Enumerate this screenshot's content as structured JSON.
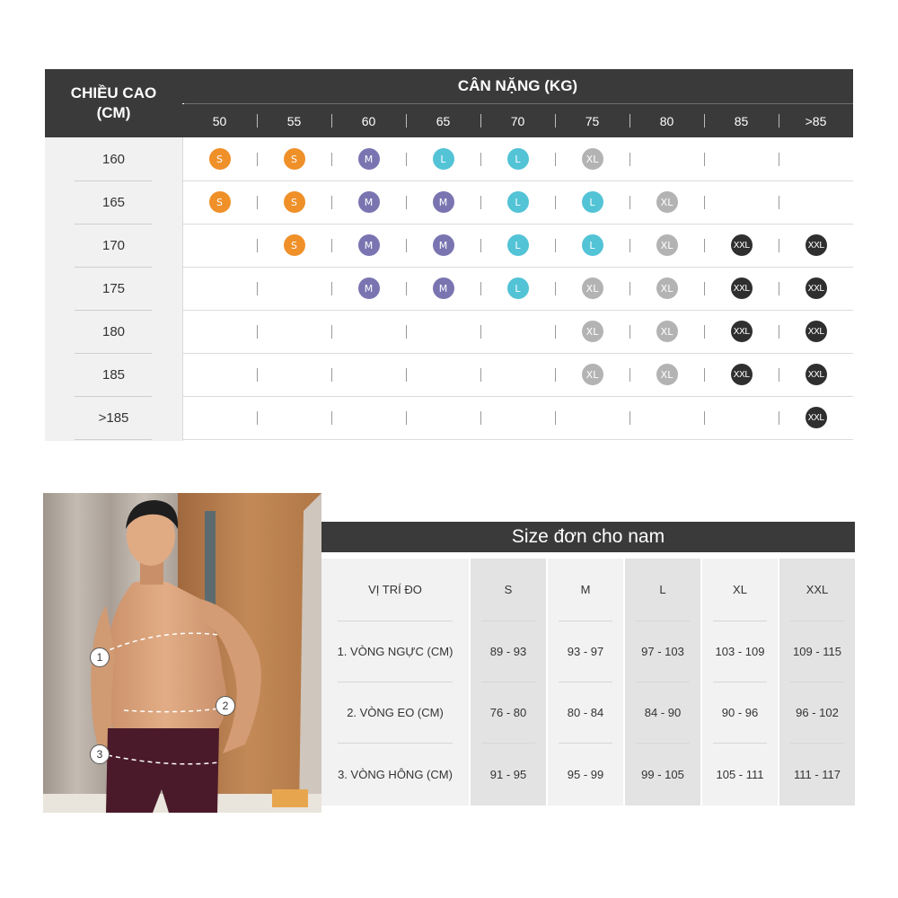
{
  "size_chart": {
    "height_header": "CHIỀU CAO\n(CM)",
    "weight_header": "CÂN NẶNG (KG)",
    "weights": [
      "50",
      "55",
      "60",
      "65",
      "70",
      "75",
      "80",
      "85",
      ">85"
    ],
    "heights": [
      "160",
      "165",
      "170",
      "175",
      "180",
      "185",
      ">185"
    ],
    "grid": [
      [
        "S",
        "S",
        "M",
        "L",
        "L",
        "XL",
        "",
        "",
        ""
      ],
      [
        "S",
        "S",
        "M",
        "M",
        "L",
        "L",
        "XL",
        "",
        ""
      ],
      [
        "",
        "S",
        "M",
        "M",
        "L",
        "L",
        "XL",
        "XXL",
        "XXL"
      ],
      [
        "",
        "",
        "M",
        "M",
        "L",
        "XL",
        "XL",
        "XXL",
        "XXL"
      ],
      [
        "",
        "",
        "",
        "",
        "",
        "XL",
        "XL",
        "XXL",
        "XXL"
      ],
      [
        "",
        "",
        "",
        "",
        "",
        "XL",
        "XL",
        "XXL",
        "XXL"
      ],
      [
        "",
        "",
        "",
        "",
        "",
        "",
        "",
        "",
        "XXL"
      ]
    ],
    "colors": {
      "S": "#ef9029",
      "M": "#7a75b1",
      "L": "#53c3d6",
      "XL": "#b3b3b3",
      "XXL": "#2f2f2f",
      "header": "#3a3a3a"
    }
  },
  "photo": {
    "markers": [
      "1",
      "2",
      "3"
    ]
  },
  "measurement_table": {
    "title": "Size đơn cho nam",
    "columns": [
      "VỊ TRÍ ĐO",
      "S",
      "M",
      "L",
      "XL",
      "XXL"
    ],
    "rows": [
      [
        "1. VÒNG NGỰC (CM)",
        "89 - 93",
        "93 - 97",
        "97 - 103",
        "103 - 109",
        "109 - 115"
      ],
      [
        "2. VÒNG EO (CM)",
        "76 - 80",
        "80 - 84",
        "84 - 90",
        "90 - 96",
        "96 - 102"
      ],
      [
        "3. VÒNG HÔNG (CM)",
        "91 - 95",
        "95 - 99",
        "99 - 105",
        "105 - 111",
        "111 - 117"
      ]
    ]
  }
}
